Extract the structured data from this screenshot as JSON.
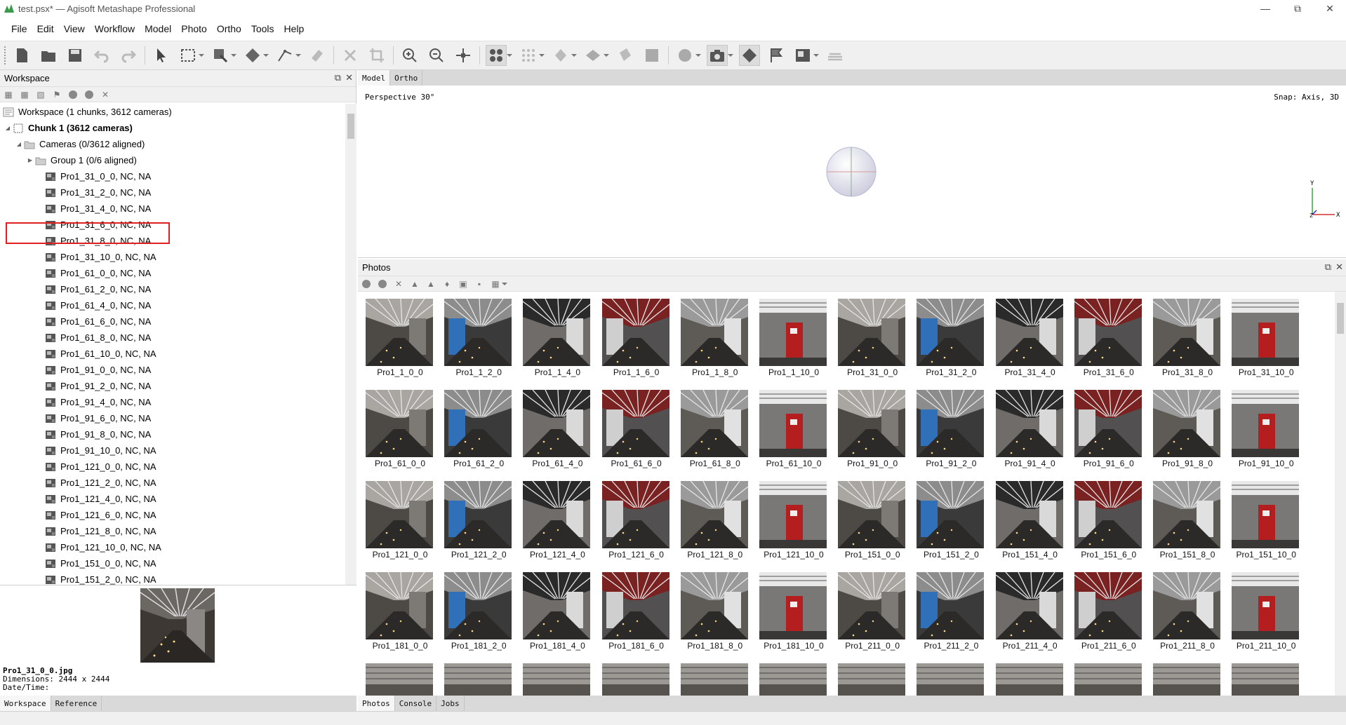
{
  "window": {
    "title": "test.psx* — Agisoft Metashape Professional",
    "controls": [
      "minimize",
      "restore",
      "close"
    ]
  },
  "menubar": {
    "items": [
      {
        "label": "File"
      },
      {
        "label": "Edit"
      },
      {
        "label": "View"
      },
      {
        "label": "Workflow"
      },
      {
        "label": "Model"
      },
      {
        "label": "Photo"
      },
      {
        "label": "Ortho"
      },
      {
        "label": "Tools"
      },
      {
        "label": "Help"
      }
    ]
  },
  "toolbar": {
    "buttons": [
      "new-icon",
      "open-icon",
      "save-icon",
      "undo-icon",
      "redo-icon",
      "navigation-icon",
      "rect-select-icon",
      "resize-region-icon",
      "rotate-object-icon",
      "ruler-icon",
      "eraser-icon",
      "delete-icon",
      "crop-icon",
      "zoom-in-icon",
      "zoom-out-icon",
      "move-icon",
      "show-cameras-icon",
      "show-points-icon",
      "show-dense-icon",
      "show-mesh-icon",
      "show-texture-icon",
      "show-tiled-icon",
      "sphere-icon",
      "camera-icon",
      "region-icon",
      "markers-icon",
      "image-icon",
      "layers-icon"
    ]
  },
  "workspace": {
    "title": "Workspace",
    "root": "Workspace (1 chunks, 3612 cameras)",
    "chunk": "Chunk 1 (3612 cameras)",
    "cameras_folder": "Cameras (0/3612 aligned)",
    "group": "Group 1 (0/6 aligned)",
    "cameras": [
      "Pro1_31_0_0, NC, NA",
      "Pro1_31_2_0, NC, NA",
      "Pro1_31_4_0, NC, NA",
      "Pro1_31_6_0, NC, NA",
      "Pro1_31_8_0, NC, NA",
      "Pro1_31_10_0, NC, NA",
      "Pro1_61_0_0, NC, NA",
      "Pro1_61_2_0, NC, NA",
      "Pro1_61_4_0, NC, NA",
      "Pro1_61_6_0, NC, NA",
      "Pro1_61_8_0, NC, NA",
      "Pro1_61_10_0, NC, NA",
      "Pro1_91_0_0, NC, NA",
      "Pro1_91_2_0, NC, NA",
      "Pro1_91_4_0, NC, NA",
      "Pro1_91_6_0, NC, NA",
      "Pro1_91_8_0, NC, NA",
      "Pro1_91_10_0, NC, NA",
      "Pro1_121_0_0, NC, NA",
      "Pro1_121_2_0, NC, NA",
      "Pro1_121_4_0, NC, NA",
      "Pro1_121_6_0, NC, NA",
      "Pro1_121_8_0, NC, NA",
      "Pro1_121_10_0, NC, NA",
      "Pro1_151_0_0, NC, NA",
      "Pro1_151_2_0, NC, NA"
    ]
  },
  "preview": {
    "filename": "Pro1_31_0_0.jpg",
    "dimensions": "Dimensions: 2444 x 2444",
    "datetime": "Date/Time:"
  },
  "left_tabs": [
    "Workspace",
    "Reference"
  ],
  "model": {
    "tabs": [
      "Model",
      "Ortho"
    ],
    "perspective": "Perspective 30°",
    "snap": "Snap: Axis, 3D",
    "axis_y": "Y",
    "axis_x": "X",
    "axis_z": "Z"
  },
  "photos": {
    "title": "Photos",
    "thumbnails": [
      "Pro1_1_0_0",
      "Pro1_1_2_0",
      "Pro1_1_4_0",
      "Pro1_1_6_0",
      "Pro1_1_8_0",
      "Pro1_1_10_0",
      "Pro1_31_0_0",
      "Pro1_31_2_0",
      "Pro1_31_4_0",
      "Pro1_31_6_0",
      "Pro1_31_8_0",
      "Pro1_31_10_0",
      "Pro1_61_0_0",
      "Pro1_61_2_0",
      "Pro1_61_4_0",
      "Pro1_61_6_0",
      "Pro1_61_8_0",
      "Pro1_61_10_0",
      "Pro1_91_0_0",
      "Pro1_91_2_0",
      "Pro1_91_4_0",
      "Pro1_91_6_0",
      "Pro1_91_8_0",
      "Pro1_91_10_0",
      "Pro1_121_0_0",
      "Pro1_121_2_0",
      "Pro1_121_4_0",
      "Pro1_121_6_0",
      "Pro1_121_8_0",
      "Pro1_121_10_0",
      "Pro1_151_0_0",
      "Pro1_151_2_0",
      "Pro1_151_4_0",
      "Pro1_151_6_0",
      "Pro1_151_8_0",
      "Pro1_151_10_0",
      "Pro1_181_0_0",
      "Pro1_181_2_0",
      "Pro1_181_4_0",
      "Pro1_181_6_0",
      "Pro1_181_8_0",
      "Pro1_181_10_0",
      "Pro1_211_0_0",
      "Pro1_211_2_0",
      "Pro1_211_4_0",
      "Pro1_211_6_0",
      "Pro1_211_8_0",
      "Pro1_211_10_0"
    ]
  },
  "bottom_tabs": [
    "Photos",
    "Console",
    "Jobs"
  ],
  "colors": {
    "highlight_box": "#e02020",
    "panel_bg": "#f0f0f0"
  }
}
